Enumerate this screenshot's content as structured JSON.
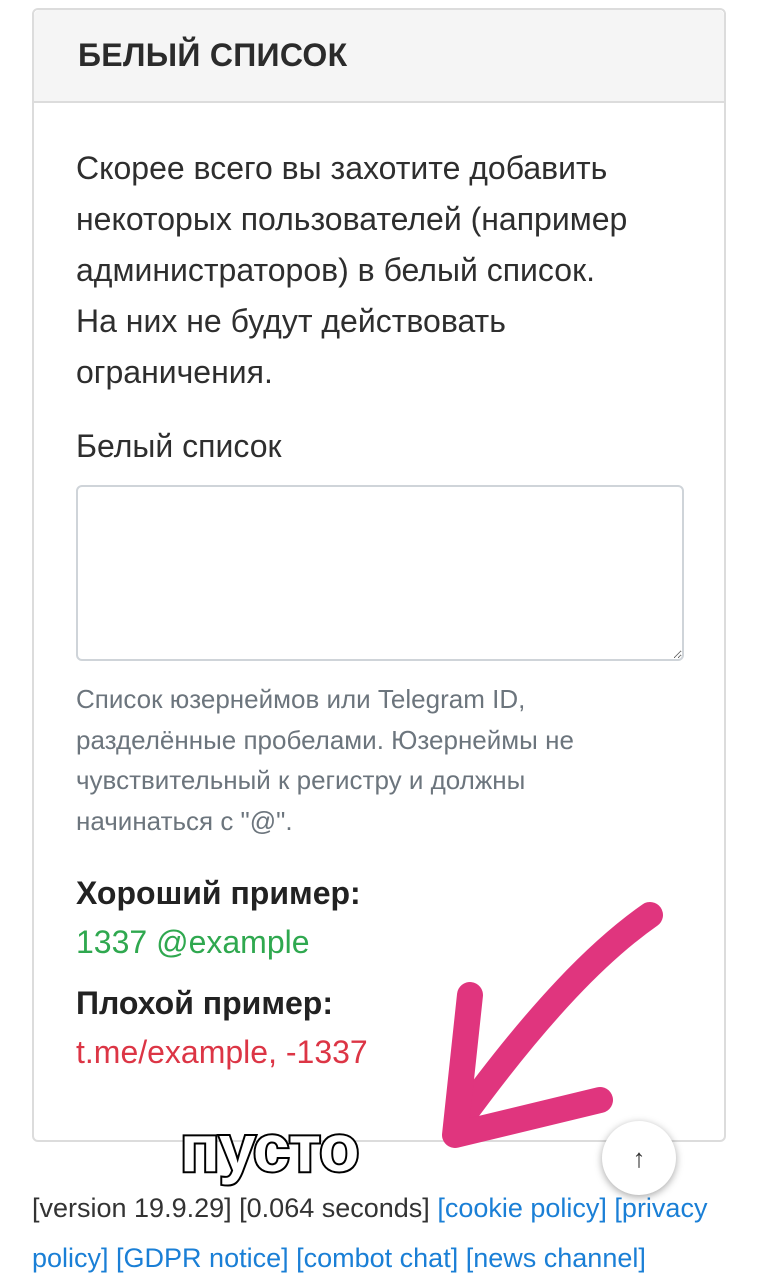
{
  "card": {
    "title": "БЕЛЫЙ СПИСОК",
    "intro_lines": [
      "Скорее всего вы захотите добавить",
      "некоторых пользователей (например",
      "администраторов) в белый список.",
      "На них не будут действовать",
      "ограничения."
    ],
    "field_label": "Белый список",
    "field_value": "",
    "help_lines": [
      "Список юзернеймов или Telegram ID,",
      "разделённые пробелами. Юзернеймы не",
      "чувствительный к регистру и должны",
      "начинаться с \"@\"."
    ],
    "good_example_label": "Хороший пример:",
    "good_example_value": "1337 @example",
    "bad_example_label": "Плохой пример:",
    "bad_example_value": "t.me/example, -1337"
  },
  "footer": {
    "version": "[version 19.9.29]",
    "timing": "[0.064 seconds]",
    "links": {
      "cookie_policy": "[cookie policy]",
      "privacy_policy_1": "[privacy",
      "privacy_policy_2": "policy]",
      "gdpr_notice": "[GDPR notice]",
      "combot_chat": "[combot chat]",
      "news_channel": "[news channel]"
    }
  },
  "scroll_top": {
    "icon": "arrow-up-icon",
    "glyph": "↑"
  },
  "annotation": {
    "sticker_text": "пусто",
    "arrow_color": "#e0357e"
  },
  "colors": {
    "link": "#1a7fd6",
    "good": "#2fa84f",
    "bad": "#dc3545",
    "muted": "#6c757d"
  }
}
